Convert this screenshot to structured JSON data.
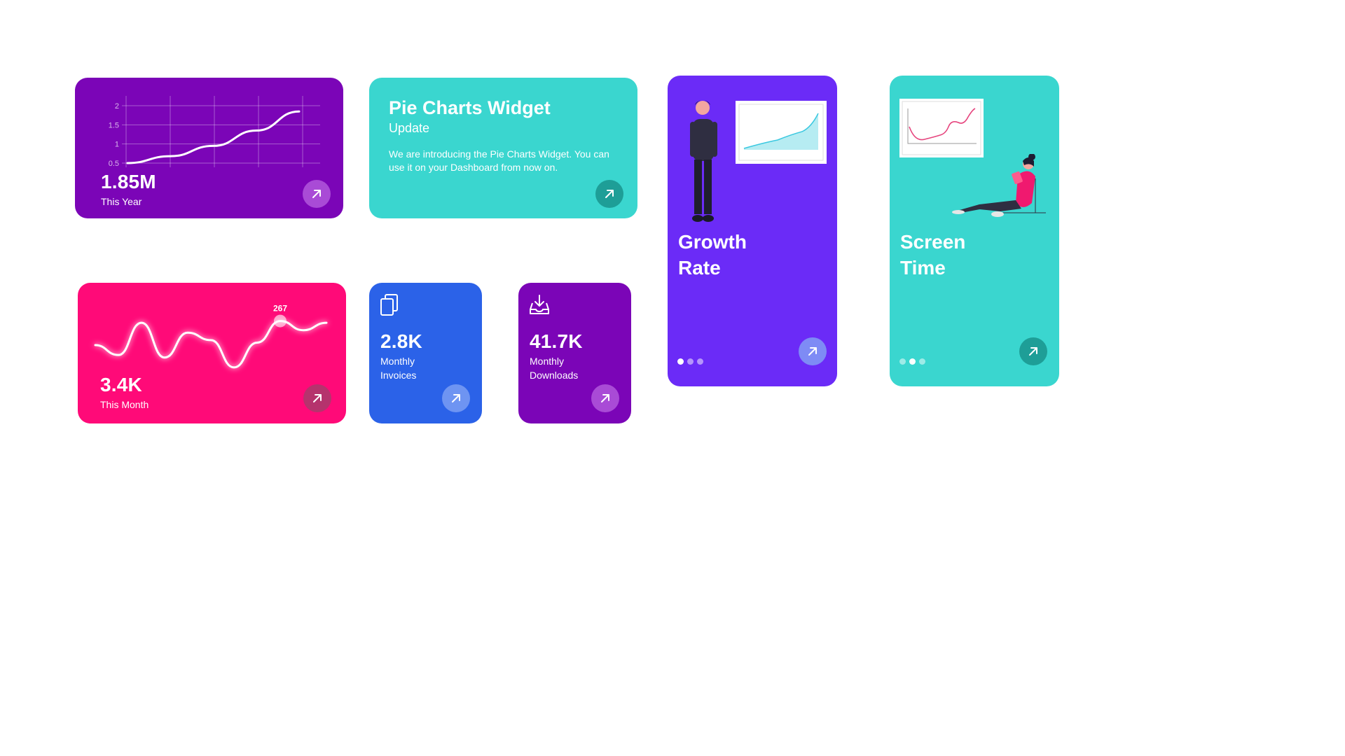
{
  "colors": {
    "purple": "#7B05B7",
    "teal": "#3AD6CF",
    "violet": "#6B2BF7",
    "pink": "#FF0A78",
    "blue": "#2B62E8",
    "white": "#FFFFFF"
  },
  "year_card": {
    "value": "1.85M",
    "label": "This Year",
    "chart_data": {
      "type": "line",
      "yticks": [
        "2",
        "1.5",
        "1",
        "0.5"
      ],
      "ylim": [
        0.5,
        2
      ],
      "x": [
        0,
        1,
        2,
        3,
        4
      ],
      "y": [
        0.5,
        0.68,
        0.95,
        1.35,
        1.85
      ]
    }
  },
  "pie_widget_card": {
    "title": "Pie Charts Widget",
    "subtitle": "Update",
    "description": "We are introducing the Pie Charts Widget. You can use it on your Dashboard from now on."
  },
  "growth_card": {
    "title_line1": "Growth",
    "title_line2": "Rate",
    "active_dot": 0,
    "dot_count": 3
  },
  "screen_card": {
    "title_line1": "Screen",
    "title_line2": "Time",
    "active_dot": 1,
    "dot_count": 3
  },
  "month_card": {
    "value": "3.4K",
    "label": "This Month",
    "peak_label": "267",
    "chart_data": {
      "type": "line",
      "x": [
        0,
        1,
        2,
        3,
        4,
        5,
        6,
        7,
        8,
        9,
        10
      ],
      "y": [
        170,
        130,
        260,
        120,
        220,
        190,
        80,
        180,
        267,
        230,
        260
      ]
    }
  },
  "invoices_card": {
    "value": "2.8K",
    "label_line1": "Monthly",
    "label_line2": "Invoices",
    "icon": "documents-icon"
  },
  "downloads_card": {
    "value": "41.7K",
    "label_line1": "Monthly",
    "label_line2": "Downloads",
    "icon": "download-tray-icon"
  }
}
